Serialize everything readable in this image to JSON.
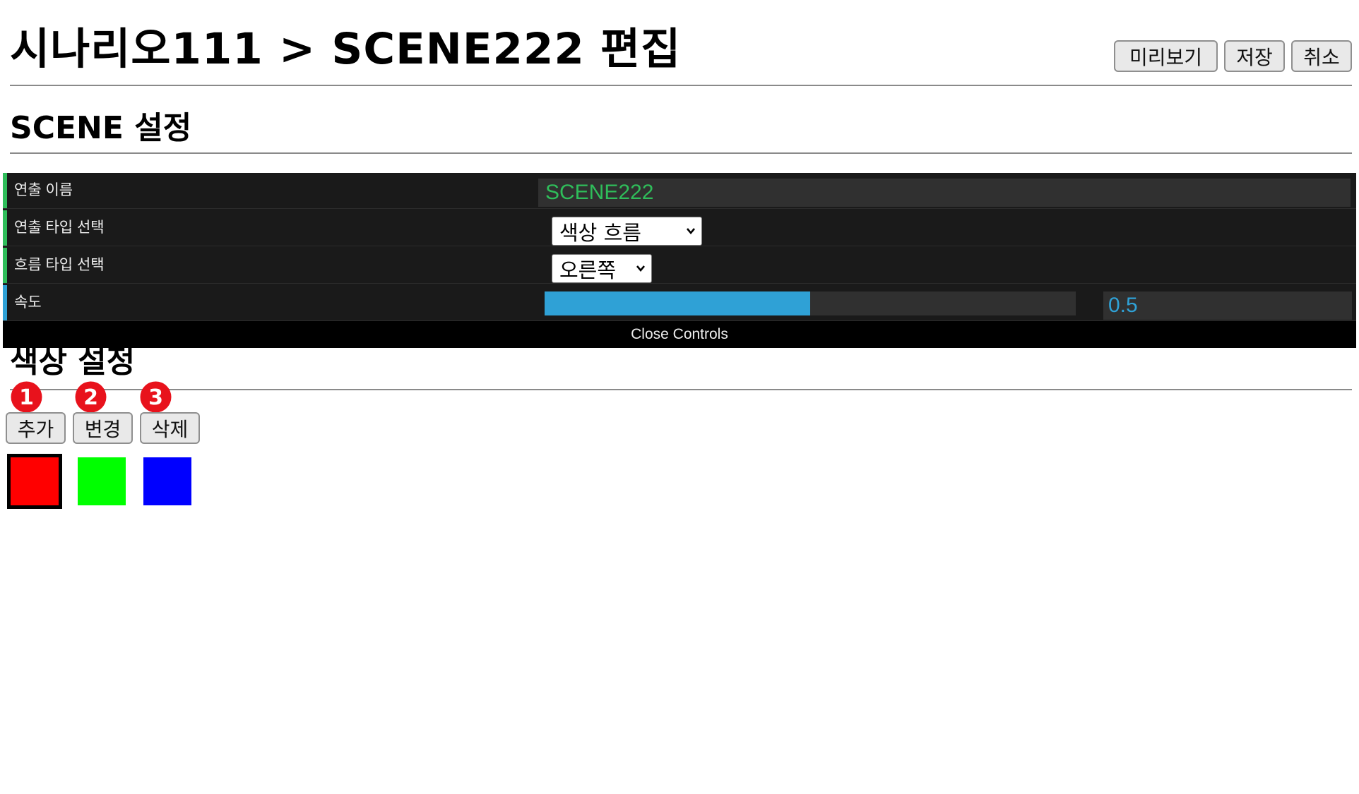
{
  "header": {
    "title": "시나리오111 > SCENE222 편집",
    "buttons": {
      "preview": "미리보기",
      "save": "저장",
      "cancel": "취소"
    }
  },
  "scene_section": {
    "heading": "SCENE 설정"
  },
  "controls": {
    "name_label": "연출 이름",
    "name_value": "SCENE222",
    "effect_type_label": "연출 타입 선택",
    "effect_type_value": "색상 흐름",
    "flow_type_label": "흐름 타입 선택",
    "flow_type_value": "오른쪽",
    "speed_label": "속도",
    "speed_value": "0.5",
    "close_label": "Close Controls",
    "stripe_colors": {
      "text": "#2fbd5a",
      "number": "#2fa1d6"
    }
  },
  "color_section": {
    "heading": "색상 설정",
    "buttons": {
      "add": "추가",
      "change": "변경",
      "delete": "삭제"
    },
    "markers": [
      "1",
      "2",
      "3"
    ],
    "swatches": [
      {
        "color": "#ff0000",
        "selected": true
      },
      {
        "color": "#00ff00",
        "selected": false
      },
      {
        "color": "#0000ff",
        "selected": false
      }
    ]
  }
}
